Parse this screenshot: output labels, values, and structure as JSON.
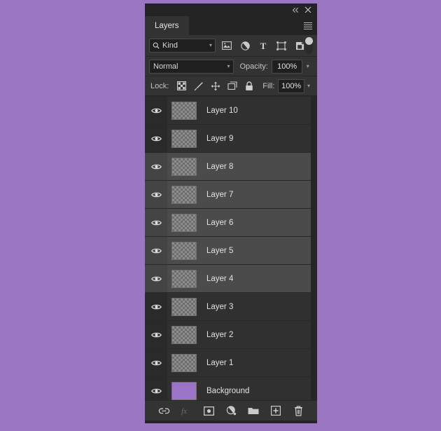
{
  "app": {
    "background_color": "#9b77c2",
    "panel_background": "#303030"
  },
  "titlebar": {
    "collapse_label": "«",
    "close_label": "✕"
  },
  "tabs": [
    {
      "label": "Layers",
      "active": true
    }
  ],
  "panel_menu": {
    "label": "Panel menu"
  },
  "filter_row": {
    "kind_label": "Kind",
    "search_icon": "search-icon",
    "filter_icons": [
      {
        "name": "filter-pixel-layers-icon",
        "title": "Pixel layers"
      },
      {
        "name": "filter-adjustment-layers-icon",
        "title": "Adjustment layers"
      },
      {
        "name": "filter-type-layers-icon",
        "title": "Type layers",
        "glyph": "T"
      },
      {
        "name": "filter-shape-layers-icon",
        "title": "Shape layers"
      },
      {
        "name": "filter-smart-object-layers-icon",
        "title": "Smart objects"
      }
    ],
    "toggle": {
      "name": "filter-enable-toggle",
      "state": "on"
    }
  },
  "blend_row": {
    "blend_mode": "Normal",
    "opacity_label": "Opacity:",
    "opacity_value": "100%"
  },
  "lock_row": {
    "lock_label": "Lock:",
    "lock_icons": [
      {
        "name": "lock-transparent-pixels-icon"
      },
      {
        "name": "lock-image-pixels-icon"
      },
      {
        "name": "lock-position-icon"
      },
      {
        "name": "lock-artboard-nesting-icon"
      },
      {
        "name": "lock-all-icon"
      }
    ],
    "fill_label": "Fill:",
    "fill_value": "100%"
  },
  "layers": [
    {
      "name": "Layer 10",
      "visible": true,
      "selected": false,
      "thumb": "transparent"
    },
    {
      "name": "Layer 9",
      "visible": true,
      "selected": false,
      "thumb": "transparent"
    },
    {
      "name": "Layer 8",
      "visible": true,
      "selected": true,
      "thumb": "transparent"
    },
    {
      "name": "Layer 7",
      "visible": true,
      "selected": true,
      "thumb": "transparent"
    },
    {
      "name": "Layer 6",
      "visible": true,
      "selected": true,
      "thumb": "transparent"
    },
    {
      "name": "Layer 5",
      "visible": true,
      "selected": true,
      "thumb": "transparent"
    },
    {
      "name": "Layer 4",
      "visible": true,
      "selected": true,
      "thumb": "transparent"
    },
    {
      "name": "Layer 3",
      "visible": true,
      "selected": false,
      "thumb": "transparent"
    },
    {
      "name": "Layer 2",
      "visible": true,
      "selected": false,
      "thumb": "transparent"
    },
    {
      "name": "Layer 1",
      "visible": true,
      "selected": false,
      "thumb": "transparent"
    },
    {
      "name": "Background",
      "visible": true,
      "selected": false,
      "thumb": "solid",
      "thumb_color": "#9b74c8"
    }
  ],
  "bottom_toolbar": [
    {
      "name": "link-layers-button",
      "icon": "link-icon",
      "enabled": true
    },
    {
      "name": "layer-style-button",
      "icon": "fx-icon",
      "enabled": false
    },
    {
      "name": "add-layer-mask-button",
      "icon": "mask-icon",
      "enabled": true
    },
    {
      "name": "new-adjustment-layer-button",
      "icon": "adjustment-icon",
      "enabled": true
    },
    {
      "name": "new-group-button",
      "icon": "folder-icon",
      "enabled": true
    },
    {
      "name": "new-layer-button",
      "icon": "plus-square-icon",
      "enabled": true
    },
    {
      "name": "delete-layer-button",
      "icon": "trash-icon",
      "enabled": true
    }
  ]
}
